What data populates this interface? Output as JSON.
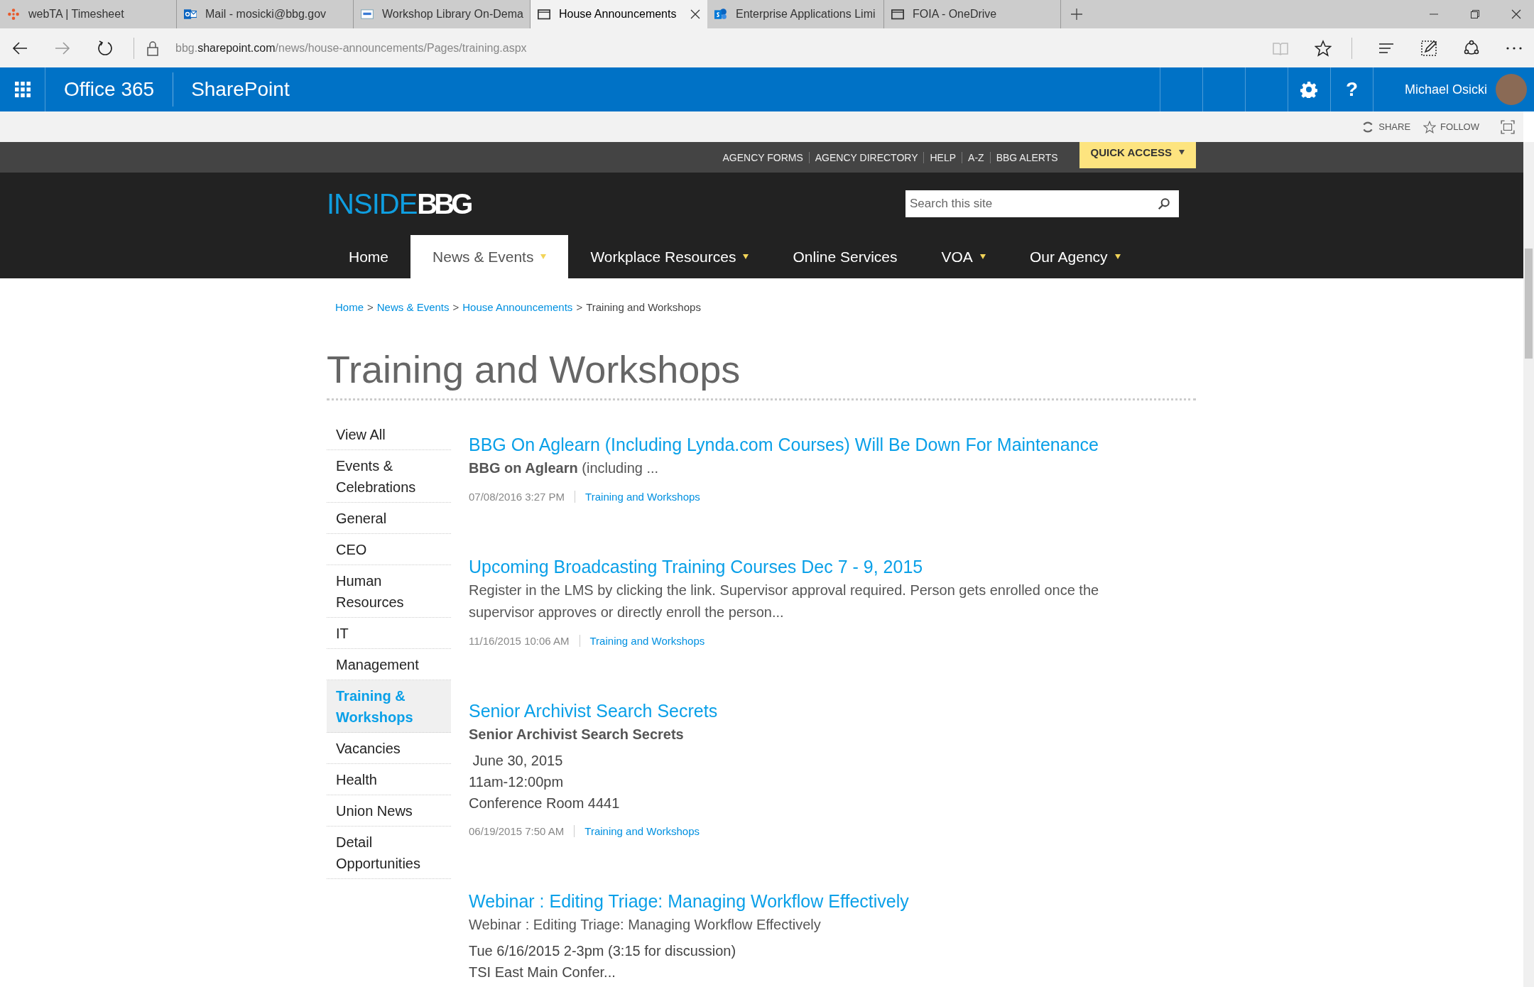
{
  "browser": {
    "tabs": [
      {
        "title": "webTA | Timesheet",
        "kind": "dots",
        "selected": false
      },
      {
        "title": "Mail - mosicki@bbg.gov",
        "kind": "mail",
        "selected": false
      },
      {
        "title": "Workshop Library On-Dema",
        "kind": "note",
        "selected": false
      },
      {
        "title": "House Announcements",
        "kind": "page",
        "selected": true
      },
      {
        "title": "Enterprise Applications Limi",
        "kind": "sites",
        "selected": false
      },
      {
        "title": "FOIA - OneDrive",
        "kind": "page",
        "selected": false
      }
    ],
    "url": {
      "host_prefix": "bbg.",
      "host": "sharepoint.com",
      "path": "/news/house-announcements/Pages/training.aspx"
    }
  },
  "suite_bar": {
    "app": "Office 365",
    "site": "SharePoint",
    "help": "?",
    "user": "Michael Osicki"
  },
  "actions": [
    "SHARE",
    "FOLLOW"
  ],
  "top_links": [
    {
      "label": "AGENCY FORMS"
    },
    {
      "label": "AGENCY DIRECTORY"
    },
    {
      "label": "HELP"
    },
    {
      "label": "A-Z"
    },
    {
      "label": "BBG ALERTS"
    }
  ],
  "quick_access": "QUICK ACCESS",
  "logo": {
    "prefix": "INSIDE",
    "suffix": "BBG"
  },
  "search": {
    "placeholder": "Search this site"
  },
  "nav": [
    {
      "label": "Home",
      "selected": false,
      "has_menu": false
    },
    {
      "label": "News & Events",
      "selected": true,
      "has_menu": true
    },
    {
      "label": "Workplace Resources",
      "selected": false,
      "has_menu": true
    },
    {
      "label": "Online Services",
      "selected": false,
      "has_menu": false
    },
    {
      "label": "VOA",
      "selected": false,
      "has_menu": true
    },
    {
      "label": "Our Agency",
      "selected": false,
      "has_menu": true
    }
  ],
  "breadcrumb": {
    "links": [
      "Home",
      "News & Events",
      "House Announcements"
    ],
    "separator": ">",
    "current": "Training and Workshops"
  },
  "page_title": "Training and Workshops",
  "categories": [
    {
      "label": "View All",
      "selected": false
    },
    {
      "label": "Events & Celebrations",
      "selected": false
    },
    {
      "label": "General",
      "selected": false
    },
    {
      "label": "CEO",
      "selected": false
    },
    {
      "label": "Human Resources",
      "selected": false
    },
    {
      "label": "IT",
      "selected": false
    },
    {
      "label": "Management",
      "selected": false
    },
    {
      "label": "Training & Workshops",
      "selected": true
    },
    {
      "label": "Vacancies",
      "selected": false
    },
    {
      "label": "Health",
      "selected": false
    },
    {
      "label": "Union News",
      "selected": false
    },
    {
      "label": "Detail Opportunities",
      "selected": false
    }
  ],
  "articles": [
    {
      "title": "BBG On Aglearn (Including Lynda.com Courses) Will Be Down For Maintenance",
      "summary": {
        "kind": "plain",
        "text": "**BBG on Aglearn** (including ..."
      },
      "date": "07/08/2016 3:27 PM",
      "category": "Training and Workshops"
    },
    {
      "title": "Upcoming Broadcasting Training Courses Dec 7 - 9, 2015",
      "summary": {
        "kind": "plain",
        "text": "Register in the LMS by clicking the link.  Supervisor approval required.  Person gets enrolled once the supervisor approves or directly enroll the person..."
      },
      "date": "11/16/2015 10:06 AM",
      "category": "Training and Workshops"
    },
    {
      "title": "Senior Archivist Search Secrets",
      "summary": {
        "kind": "bold",
        "text": "Senior Archivist Search Secrets"
      },
      "details": [
        " June 30, 2015",
        "11am-12:00pm",
        "Conference Room 4441"
      ],
      "date": "06/19/2015 7:50 AM",
      "category": "Training and Workshops"
    },
    {
      "title": "Webinar : Editing Triage: Managing Workflow Effectively",
      "summary": {
        "kind": "plain",
        "text": "Webinar : Editing Triage: Managing Workflow Effectively"
      },
      "details": [
        "Tue 6/16/2015 2-3pm (3:15 for discussion)",
        "TSI East Main Confer..."
      ]
    }
  ]
}
